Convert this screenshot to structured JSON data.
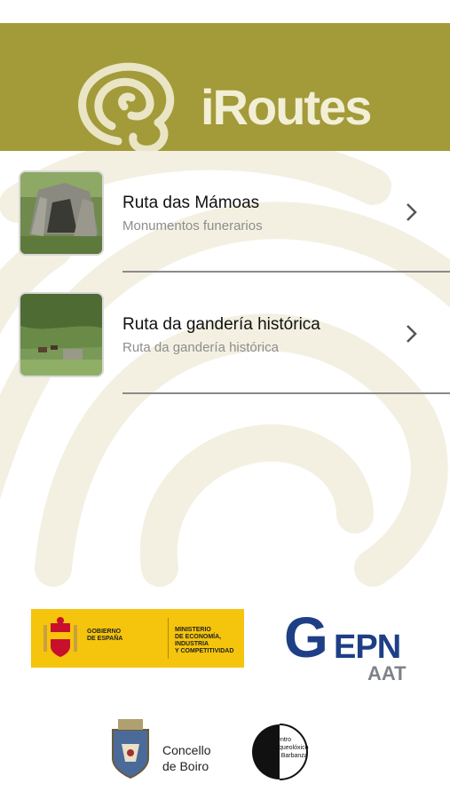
{
  "header": {
    "app_title": "iRoutes",
    "background_color": "#a39a3a"
  },
  "routes": [
    {
      "title": "Ruta das Mámoas",
      "subtitle": "Monumentos funerarios",
      "thumbnail": "dolmen-photo",
      "chevron": "chevron-right-icon"
    },
    {
      "title": "Ruta da gandería histórica",
      "subtitle": "Ruta da gandería histórica",
      "thumbnail": "pasture-photo",
      "chevron": "chevron-right-icon"
    }
  ],
  "sponsors": {
    "gobierno": {
      "line1": "GOBIERNO",
      "line2": "DE ESPAÑA",
      "ministry1": "MINISTERIO",
      "ministry2": "DE ECONOMÍA, INDUSTRIA",
      "ministry3": "Y COMPETITIVIDAD"
    },
    "gepn": {
      "g": "G",
      "epn": "EPN",
      "aat": "AAT"
    },
    "boiro": {
      "line1": "Concello",
      "line2": "de Boiro"
    },
    "centro": {
      "line1": "Centro",
      "line2": "Arqueolóxico",
      "line3": "do Barbanza"
    }
  }
}
